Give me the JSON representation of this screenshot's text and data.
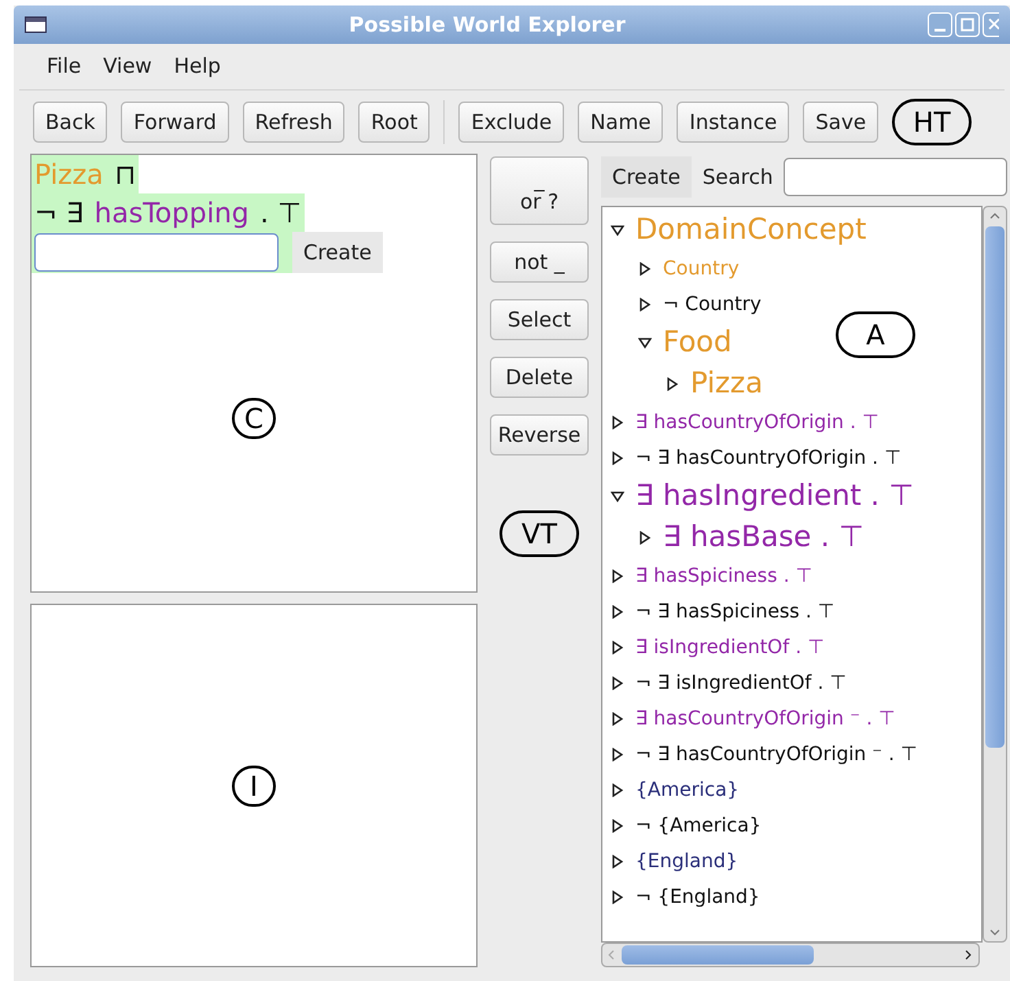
{
  "window": {
    "title": "Possible World Explorer"
  },
  "menu": [
    "File",
    "View",
    "Help"
  ],
  "toolbar": {
    "left": [
      "Back",
      "Forward",
      "Refresh",
      "Root"
    ],
    "right": [
      "Exclude",
      "Name",
      "Instance",
      "Save"
    ],
    "annotation": "HT"
  },
  "concept_editor": {
    "lines": [
      [
        {
          "text": "Pizza",
          "kind": "concept"
        },
        {
          "text": "⊓",
          "kind": "operator"
        }
      ],
      [
        {
          "text": "¬ ∃",
          "kind": "operator"
        },
        {
          "text": "hasTopping",
          "kind": "role"
        },
        {
          "text": ". ⊤",
          "kind": "operator"
        }
      ]
    ],
    "create_button": "Create",
    "annotation": "C"
  },
  "instance_panel": {
    "annotation": "I"
  },
  "actions": {
    "buttons": [
      [
        "_",
        "or ?"
      ],
      [
        "not _"
      ],
      [
        "Select"
      ],
      [
        "Delete"
      ],
      [
        "Reverse"
      ]
    ],
    "annotation": "VT"
  },
  "browser": {
    "create_tab": "Create",
    "search_label": "Search",
    "annotation": "A",
    "items": [
      {
        "text": "DomainConcept",
        "kind": "concept",
        "prominent": true,
        "expanded": true,
        "children": [
          {
            "text": "Country",
            "kind": "concept",
            "prominent": false,
            "expanded": false
          },
          {
            "text": "¬ Country",
            "kind": "negated",
            "prominent": false,
            "expanded": false
          },
          {
            "text": "Food",
            "kind": "concept",
            "prominent": true,
            "expanded": true,
            "children": [
              {
                "text": "Pizza",
                "kind": "concept",
                "prominent": true,
                "expanded": false
              }
            ]
          }
        ]
      },
      {
        "text": "∃ hasCountryOfOrigin . ⊤",
        "kind": "role",
        "prominent": false,
        "expanded": false
      },
      {
        "text": "¬ ∃ hasCountryOfOrigin . ⊤",
        "kind": "negated",
        "prominent": false,
        "expanded": false
      },
      {
        "text": "∃ hasIngredient . ⊤",
        "kind": "role",
        "prominent": true,
        "expanded": true,
        "children": [
          {
            "text": "∃ hasBase . ⊤",
            "kind": "role",
            "prominent": true,
            "expanded": false
          }
        ]
      },
      {
        "text": "∃ hasSpiciness . ⊤",
        "kind": "role",
        "prominent": false,
        "expanded": false
      },
      {
        "text": "¬ ∃ hasSpiciness . ⊤",
        "kind": "negated",
        "prominent": false,
        "expanded": false
      },
      {
        "text": "∃ isIngredientOf . ⊤",
        "kind": "role",
        "prominent": false,
        "expanded": false
      },
      {
        "text": "¬ ∃ isIngredientOf . ⊤",
        "kind": "negated",
        "prominent": false,
        "expanded": false
      },
      {
        "text": "∃ hasCountryOfOrigin ⁻ . ⊤",
        "kind": "role",
        "prominent": false,
        "expanded": false
      },
      {
        "text": "¬ ∃ hasCountryOfOrigin ⁻ . ⊤",
        "kind": "negated",
        "prominent": false,
        "expanded": false
      },
      {
        "text": "{America}",
        "kind": "nominal",
        "prominent": false,
        "expanded": false
      },
      {
        "text": "¬ {America}",
        "kind": "negated",
        "prominent": false,
        "expanded": false
      },
      {
        "text": "{England}",
        "kind": "nominal",
        "prominent": false,
        "expanded": false
      },
      {
        "text": "¬ {England}",
        "kind": "negated",
        "prominent": false,
        "expanded": false
      }
    ]
  }
}
